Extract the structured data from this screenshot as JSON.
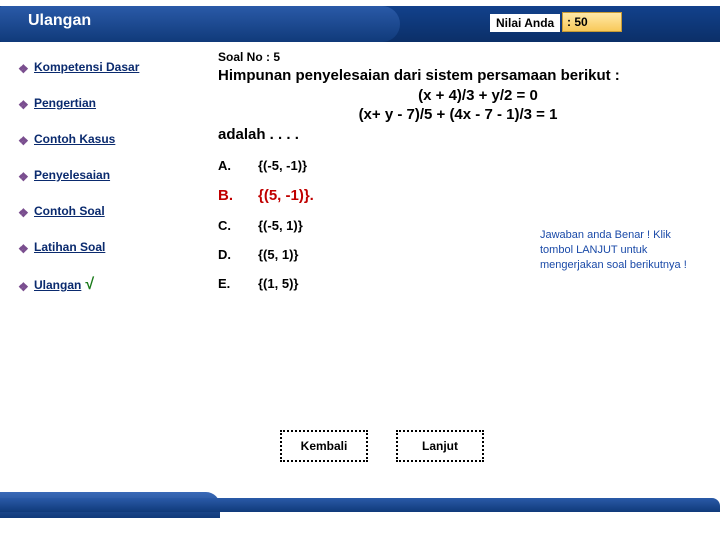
{
  "header": {
    "title": "Ulangan",
    "score_label": "Nilai Anda",
    "score_value": ": 50"
  },
  "sidebar": {
    "items": [
      {
        "label": "Kompetensi Dasar",
        "checked": false
      },
      {
        "label": "Pengertian",
        "checked": false
      },
      {
        "label": "Contoh Kasus",
        "checked": false
      },
      {
        "label": "Penyelesaian",
        "checked": false
      },
      {
        "label": "Contoh Soal",
        "checked": false
      },
      {
        "label": "Latihan Soal",
        "checked": false
      },
      {
        "label": "Ulangan",
        "checked": true
      }
    ]
  },
  "question": {
    "number_label": "Soal No : 5",
    "line1": "Himpunan penyelesaian dari sistem persamaan berikut :",
    "line2": "(x + 4)/3 + y/2 = 0",
    "line3": "(x+ y - 7)/5 + (4x - 7 - 1)/3 = 1",
    "line4": "adalah . . . ."
  },
  "options": [
    {
      "letter": "A.",
      "text": "{(-5, -1)}",
      "correct": false
    },
    {
      "letter": "B.",
      "text": "{(5, -1)}.",
      "correct": true
    },
    {
      "letter": "C.",
      "text": "{(-5, 1)}",
      "correct": false
    },
    {
      "letter": "D.",
      "text": "{(5, 1)}",
      "correct": false
    },
    {
      "letter": "E.",
      "text": "{(1, 5)}",
      "correct": false
    }
  ],
  "feedback": "Jawaban anda Benar ! Klik tombol LANJUT untuk mengerjakan soal berikutnya !",
  "buttons": {
    "back": "Kembali",
    "next": "Lanjut"
  },
  "check_mark": "√"
}
